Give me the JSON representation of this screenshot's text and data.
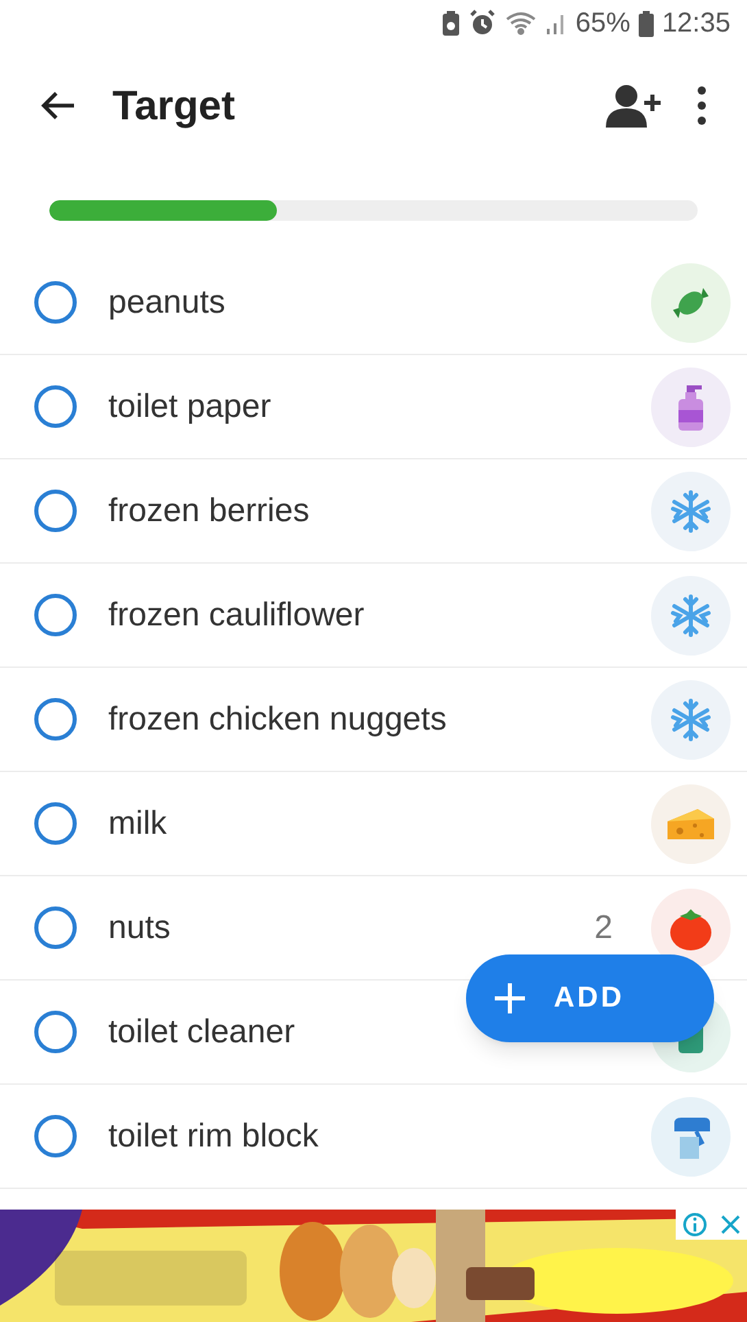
{
  "status_bar": {
    "battery": "65%",
    "time": "12:35"
  },
  "header": {
    "title": "Target"
  },
  "progress": {
    "level": 0.35
  },
  "items": [
    {
      "name": "peanuts",
      "checked": false,
      "kind": "candy"
    },
    {
      "name": "toilet paper",
      "checked": false,
      "kind": "soap"
    },
    {
      "name": "frozen berries",
      "checked": false,
      "kind": "frozen"
    },
    {
      "name": "frozen cauliflower",
      "checked": false,
      "kind": "frozen"
    },
    {
      "name": "frozen chicken nuggets",
      "checked": false,
      "kind": "frozen"
    },
    {
      "name": "milk",
      "checked": false,
      "kind": "dairy"
    },
    {
      "name": "nuts",
      "checked": false,
      "kind": "produce",
      "count": "2"
    },
    {
      "name": "toilet cleaner",
      "checked": false,
      "kind": "cleaner"
    },
    {
      "name": "toilet rim block",
      "checked": false,
      "kind": "spray"
    }
  ],
  "fab": {
    "label": "ADD"
  }
}
